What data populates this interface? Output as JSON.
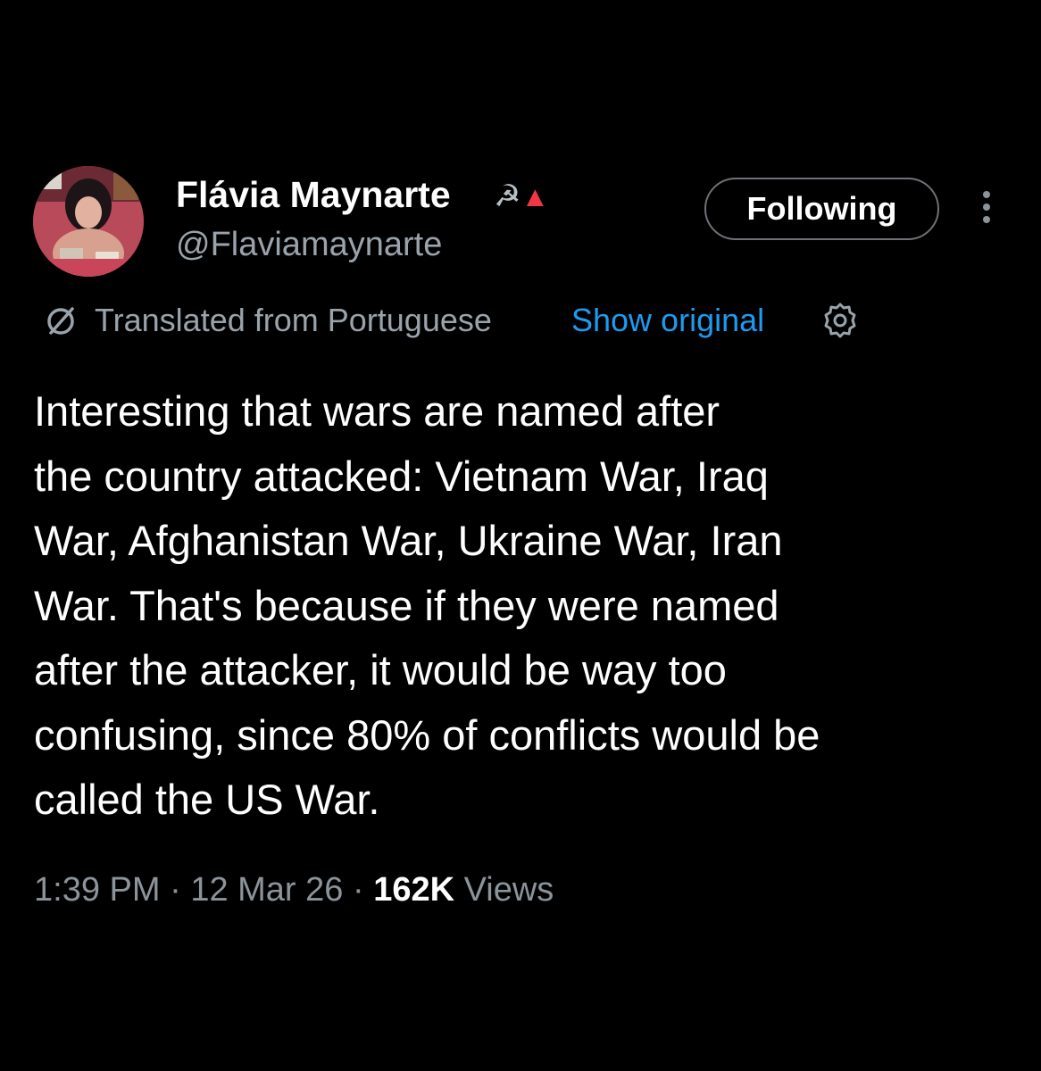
{
  "author": {
    "display_name": "Flávia Maynarte",
    "name_emoji_sickle": "☭",
    "name_emoji_triangle": "▲",
    "handle": "@Flaviamaynarte"
  },
  "actions": {
    "follow_label": "Following"
  },
  "translation": {
    "label": "Translated from Portuguese",
    "show_original": "Show original"
  },
  "tweet": {
    "lines": [
      "Interesting that wars are named after",
      "the country attacked: Vietnam War, Iraq",
      "War, Afghanistan War, Ukraine War, Iran",
      "War. That's because if they were named",
      "after the attacker, it would be way too",
      "confusing, since 80% of conflicts would be",
      "called the US War."
    ]
  },
  "meta": {
    "time": "1:39 PM",
    "separator": " · ",
    "date": "12 Mar 26",
    "views_count": "162K",
    "views_label": " Views"
  },
  "icons": {
    "translate": "translate-icon",
    "settings": "settings-icon",
    "more": "more-icon"
  },
  "colors": {
    "background": "#000000",
    "text": "#ffffff",
    "secondary_text": "#9aa3ab",
    "link": "#1d9bf0",
    "accent_red": "#f23645"
  }
}
